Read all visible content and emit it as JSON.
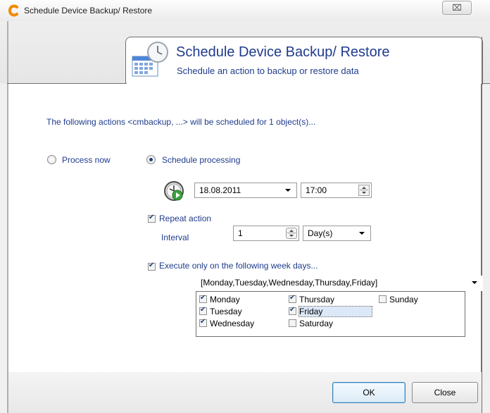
{
  "window": {
    "title": "Schedule Device Backup/ Restore",
    "close_glyph": "⌧"
  },
  "header": {
    "title": "Schedule Device Backup/ Restore",
    "subtitle": "Schedule an action to backup or restore data",
    "icon": "calendar-clock-icon"
  },
  "info_text": "The following actions <cmbackup, ...> will be scheduled for 1 object(s)...",
  "options": {
    "process_now_label": "Process now",
    "schedule_processing_label": "Schedule processing",
    "selected": "schedule_processing"
  },
  "schedule": {
    "date": "18.08.2011",
    "time": "17:00"
  },
  "repeat": {
    "label": "Repeat action",
    "checked": true,
    "interval_label": "Interval",
    "interval_value": "1",
    "interval_unit": "Day(s)"
  },
  "weekdays": {
    "label": "Execute only on the following week days...",
    "checked": true,
    "summary": "[Monday,Tuesday,Wednesday,Thursday,Friday]",
    "days": [
      {
        "label": "Monday",
        "checked": true
      },
      {
        "label": "Tuesday",
        "checked": true
      },
      {
        "label": "Wednesday",
        "checked": true
      },
      {
        "label": "Thursday",
        "checked": true
      },
      {
        "label": "Friday",
        "checked": true
      },
      {
        "label": "Saturday",
        "checked": false
      },
      {
        "label": "Sunday",
        "checked": false
      }
    ]
  },
  "buttons": {
    "ok": "OK",
    "close": "Close"
  },
  "colors": {
    "label_blue": "#1f3c8c",
    "accent": "#3c7fb1"
  }
}
